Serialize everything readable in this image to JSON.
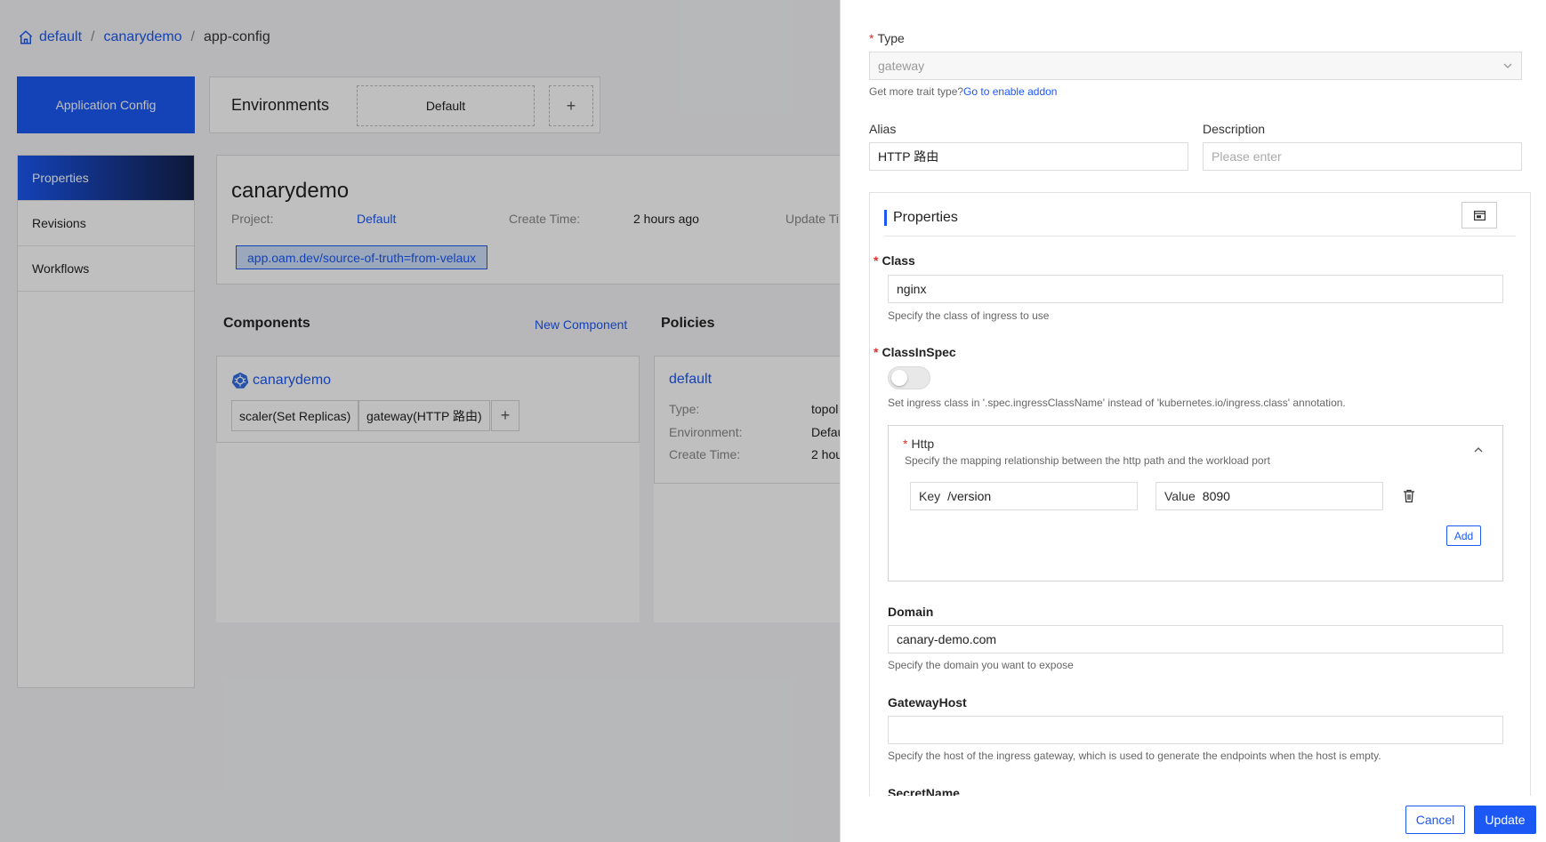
{
  "breadcrumb": {
    "home": "default",
    "app": "canarydemo",
    "current": "app-config",
    "separator": "/"
  },
  "app_config_label": "Application Config",
  "environments": {
    "title": "Environments",
    "default_env": "Default",
    "add_label": "+"
  },
  "left_nav": [
    {
      "label": "Properties",
      "active": true
    },
    {
      "label": "Revisions",
      "active": false
    },
    {
      "label": "Workflows",
      "active": false
    }
  ],
  "app_info": {
    "name": "canarydemo",
    "project_label": "Project:",
    "project_value": "Default",
    "create_time_label": "Create Time:",
    "create_time_value": "2 hours ago",
    "update_time_label": "Update Ti",
    "tag": "app.oam.dev/source-of-truth=from-velaux"
  },
  "components": {
    "title": "Components",
    "new_label": "New Component",
    "card": {
      "name": "canarydemo",
      "traits": [
        "scaler(Set Replicas)",
        "gateway(HTTP 路由)"
      ],
      "add_label": "+"
    }
  },
  "policies": {
    "title": "Policies",
    "card": {
      "name": "default",
      "rows": [
        {
          "label": "Type:",
          "value": "topol"
        },
        {
          "label": "Environment:",
          "value": "Defau"
        },
        {
          "label": "Create Time:",
          "value": "2 hou"
        }
      ]
    }
  },
  "drawer": {
    "type_label": "Type",
    "type_value": "gateway",
    "trait_hint": "Get more trait type?",
    "trait_hint_link": "Go to enable addon",
    "alias_label": "Alias",
    "alias_value": "HTTP 路由",
    "description_label": "Description",
    "description_placeholder": "Please enter",
    "properties_title": "Properties",
    "class_label": "Class",
    "class_value": "nginx",
    "class_hint": "Specify the class of ingress to use",
    "classinspec_label": "ClassInSpec",
    "classinspec_hint": "Set ingress class in '.spec.ingressClassName' instead of 'kubernetes.io/ingress.class' annotation.",
    "http_label": "Http",
    "http_hint": "Specify the mapping relationship between the http path and the workload port",
    "http_key_label": "Key",
    "http_key_value": "/version",
    "http_value_label": "Value",
    "http_value_value": "8090",
    "add_label": "Add",
    "domain_label": "Domain",
    "domain_value": "canary-demo.com",
    "domain_hint": "Specify the domain you want to expose",
    "gatewayhost_label": "GatewayHost",
    "gatewayhost_value": "",
    "gatewayhost_hint": "Specify the host of the ingress gateway, which is used to generate the endpoints when the host is empty.",
    "secretname_label": "SecretName",
    "required_mark": "*"
  },
  "footer": {
    "cancel": "Cancel",
    "update": "Update"
  },
  "colors": {
    "primary": "#1b58f4",
    "required": "#e62e2e"
  }
}
